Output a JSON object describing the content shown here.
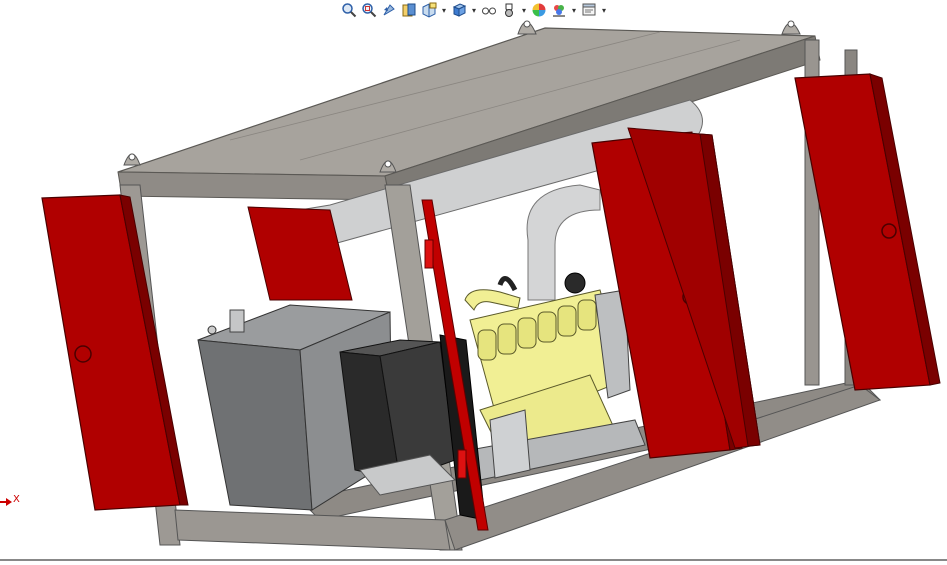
{
  "app": {
    "type": "cad-3d-viewport"
  },
  "toolbar": {
    "items": [
      {
        "name": "zoom-to-fit",
        "icon": "zoom-to-fit-icon"
      },
      {
        "name": "zoom-to-area",
        "icon": "zoom-to-area-icon"
      },
      {
        "name": "previous-view",
        "icon": "previous-view-icon"
      },
      {
        "name": "section-view",
        "icon": "section-view-icon"
      },
      {
        "name": "dynamic-annotation-views",
        "icon": "annotation-view-icon",
        "dropdown": true
      },
      {
        "name": "view-orientation",
        "icon": "view-orientation-icon",
        "dropdown": true
      },
      {
        "name": "display-style",
        "icon": "display-style-icon",
        "dropdown": true
      },
      {
        "name": "hide-show-items",
        "icon": "hide-show-icon",
        "dropdown": true
      },
      {
        "name": "edit-appearance",
        "icon": "appearance-icon"
      },
      {
        "name": "apply-scene",
        "icon": "scene-icon",
        "dropdown": true
      },
      {
        "name": "view-settings",
        "icon": "view-settings-icon",
        "dropdown": true
      }
    ],
    "dropdown_glyph": "▾"
  },
  "triad": {
    "x_label": "X"
  },
  "model": {
    "colors": {
      "frame": "#9c9994",
      "frame_dark": "#6e6b67",
      "roof": "#a8a49e",
      "door": "#b00000",
      "door_dark": "#7a0000",
      "exhaust": "#c9cacb",
      "engine": "#f1ef94",
      "tank": "#6f7173",
      "radiator": "#2a2a2a",
      "background": "#ffffff"
    }
  }
}
